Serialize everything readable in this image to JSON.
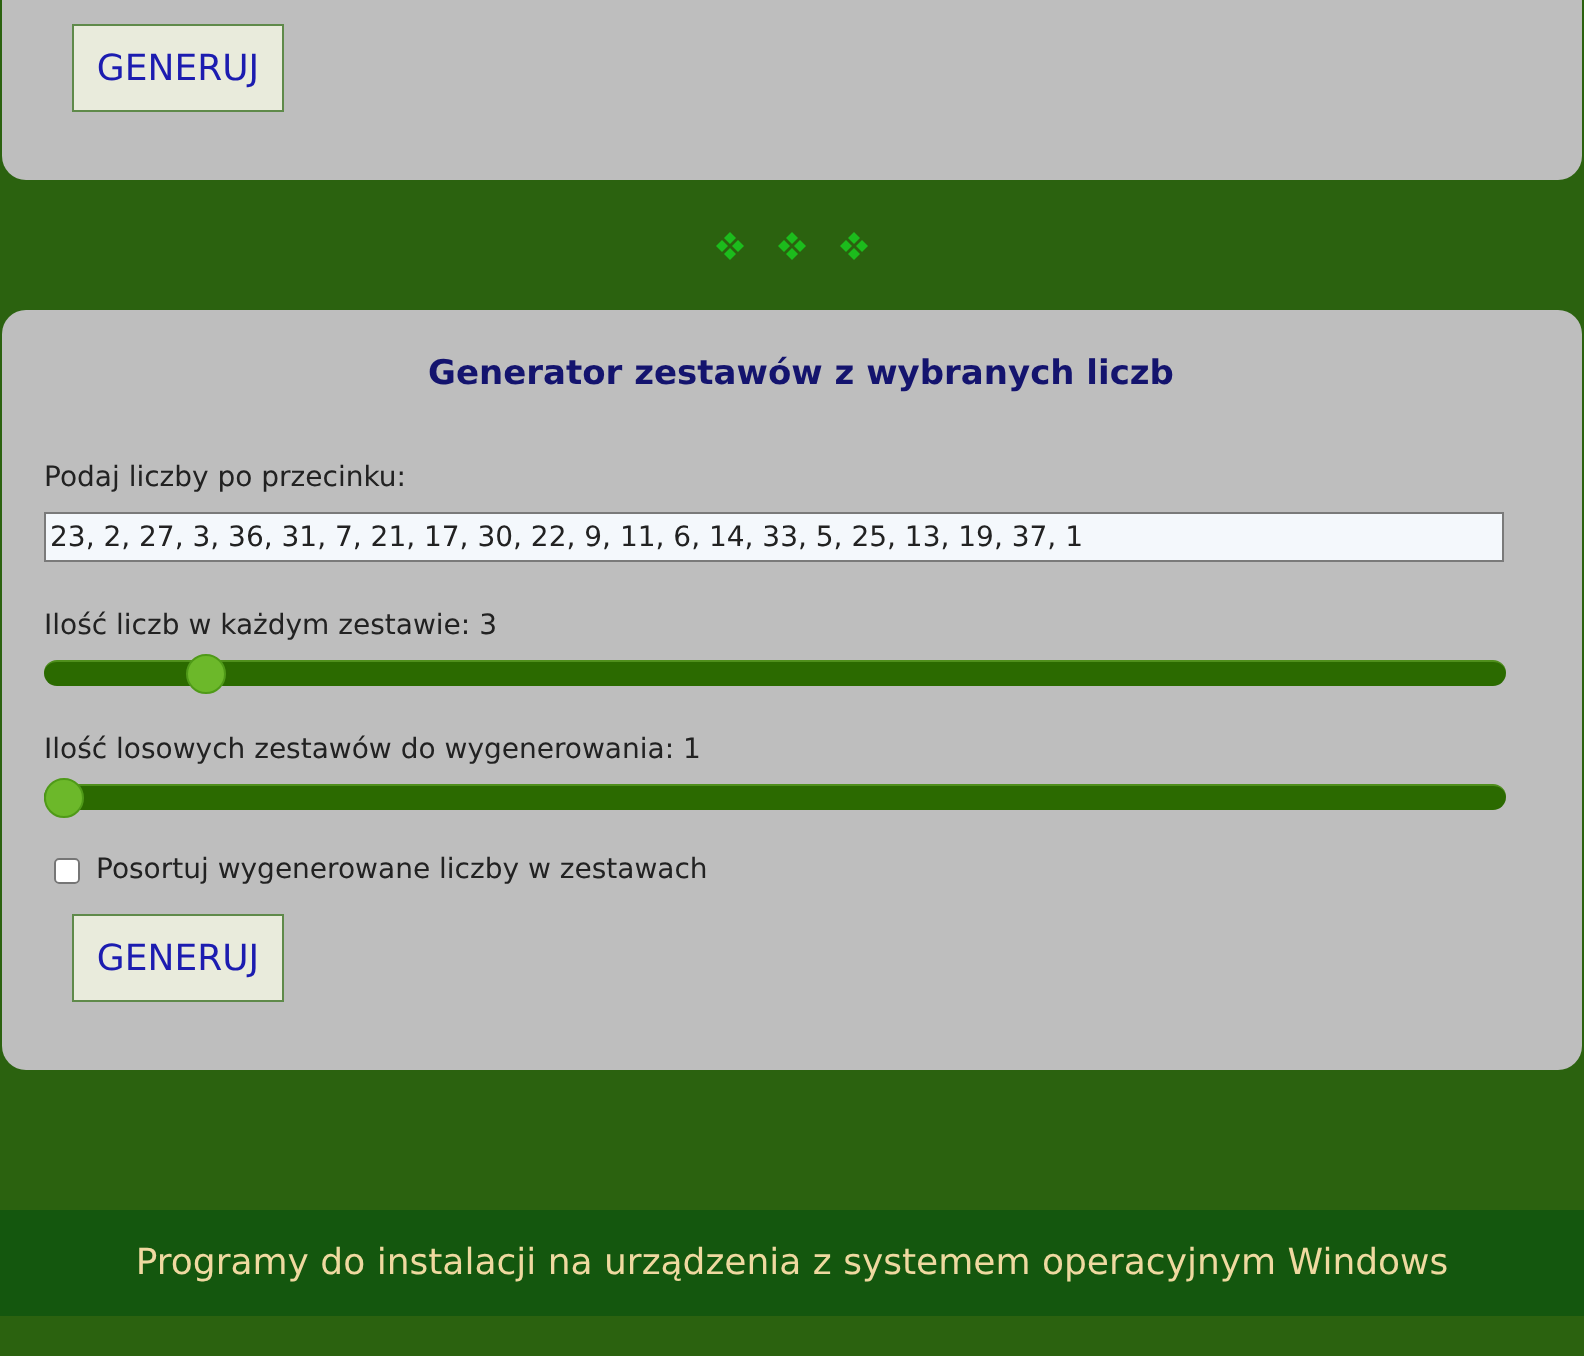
{
  "top_panel": {
    "button": "GENERUJ"
  },
  "generator": {
    "title": "Generator zestawów z wybranych liczb",
    "numbers_field": {
      "label": "Podaj liczby po przecinku:",
      "value": "23, 2, 27, 3, 36, 31, 7, 21, 17, 30, 22, 9, 11, 6, 14, 33, 5, 25, 13, 19, 37, 1"
    },
    "sliders": [
      {
        "label": "Ilość liczb w każdym zestawie: 3",
        "level": 0.1
      },
      {
        "label": "Ilość losowych zestawów do wygenerowania: 1",
        "level": 0
      }
    ],
    "sort_checkbox": {
      "label": "Posortuj wygenerowane liczby w zestawach",
      "checked": false
    },
    "button": "GENERUJ"
  },
  "footer": {
    "text": "Programy do instalacji na urządzenia z systemem operacyjnym Windows"
  }
}
